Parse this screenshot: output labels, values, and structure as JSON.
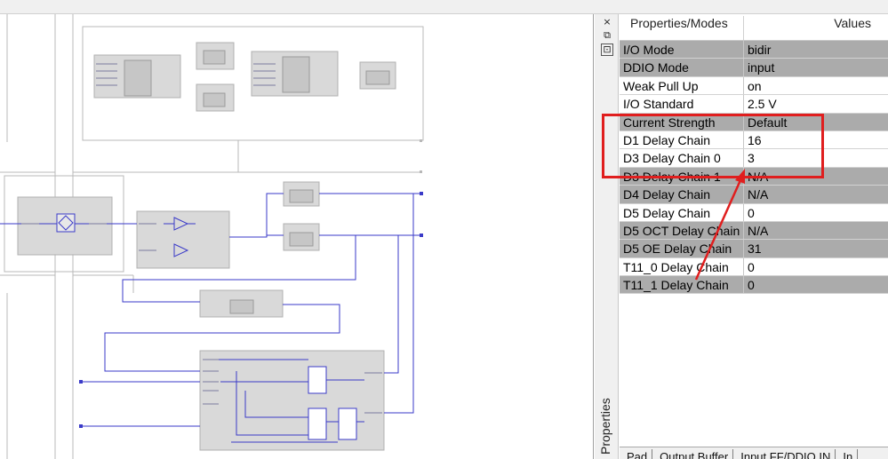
{
  "properties_panel": {
    "dock_title": "Properties",
    "header": {
      "property_col": "Properties/Modes",
      "value_col": "Values"
    },
    "rows": [
      {
        "name": "I/O Mode",
        "value": "bidir",
        "shade": "gray"
      },
      {
        "name": "DDIO Mode",
        "value": "input",
        "shade": "gray"
      },
      {
        "name": "Weak Pull Up",
        "value": "on",
        "shade": "white"
      },
      {
        "name": "I/O Standard",
        "value": "2.5 V",
        "shade": "white"
      },
      {
        "name": "Current Strength",
        "value": "Default",
        "shade": "gray"
      },
      {
        "name": "D1 Delay Chain",
        "value": "16",
        "shade": "white"
      },
      {
        "name": "D3 Delay Chain 0",
        "value": "3",
        "shade": "white"
      },
      {
        "name": "D3 Delay Chain 1",
        "value": "N/A",
        "shade": "gray"
      },
      {
        "name": "D4 Delay Chain",
        "value": "N/A",
        "shade": "gray"
      },
      {
        "name": "D5 Delay Chain",
        "value": "0",
        "shade": "white"
      },
      {
        "name": "D5 OCT Delay Chain",
        "value": "N/A",
        "shade": "gray"
      },
      {
        "name": "D5 OE Delay Chain",
        "value": "31",
        "shade": "gray"
      },
      {
        "name": "T11_0 Delay Chain",
        "value": "0",
        "shade": "white"
      },
      {
        "name": "T11_1 Delay Chain",
        "value": "0",
        "shade": "gray"
      }
    ],
    "tabs": [
      "Pad",
      "Output Buffer",
      "Input FF/DDIO IN",
      "In"
    ]
  },
  "dock_buttons": {
    "close": "×",
    "float": "⧉",
    "pin": "⊡"
  },
  "colors": {
    "annotation_red": "#e01e1e",
    "row_gray": "#ababab",
    "wire_blue": "#3a3ac8",
    "block_gray": "#d9d9d9"
  }
}
